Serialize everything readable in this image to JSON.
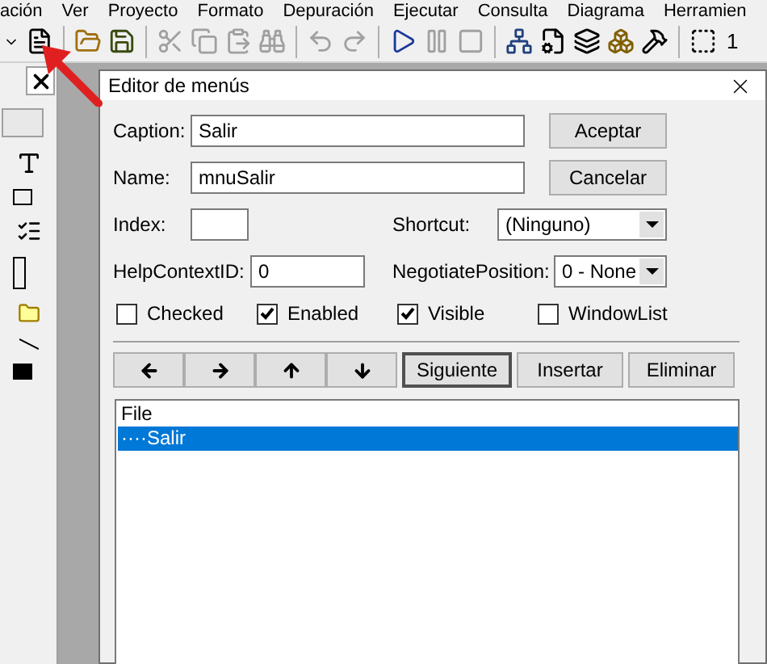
{
  "menu_bar": [
    "ación",
    "Ver",
    "Proyecto",
    "Formato",
    "Depuración",
    "Ejecutar",
    "Consulta",
    "Diagrama",
    "Herramien"
  ],
  "toolbar": [
    {
      "kind": "dropdown",
      "disabled": false
    },
    {
      "kind": "menu-editor",
      "disabled": false
    },
    {
      "kind": "sep"
    },
    {
      "kind": "open",
      "disabled": false
    },
    {
      "kind": "save",
      "disabled": false
    },
    {
      "kind": "sep"
    },
    {
      "kind": "cut",
      "disabled": true
    },
    {
      "kind": "copy",
      "disabled": true
    },
    {
      "kind": "paste",
      "disabled": true
    },
    {
      "kind": "find",
      "disabled": true
    },
    {
      "kind": "sep"
    },
    {
      "kind": "undo",
      "disabled": true
    },
    {
      "kind": "redo",
      "disabled": true
    },
    {
      "kind": "sep"
    },
    {
      "kind": "run",
      "disabled": false
    },
    {
      "kind": "pause",
      "disabled": true
    },
    {
      "kind": "stop",
      "disabled": true
    },
    {
      "kind": "sep"
    },
    {
      "kind": "project",
      "disabled": false
    },
    {
      "kind": "properties",
      "disabled": false
    },
    {
      "kind": "layout",
      "disabled": false
    },
    {
      "kind": "objects",
      "disabled": false
    },
    {
      "kind": "tools",
      "disabled": false
    },
    {
      "kind": "sep"
    },
    {
      "kind": "selection",
      "disabled": false
    }
  ],
  "toolbar_text": "1",
  "dialog": {
    "title": "Editor de menús",
    "caption": {
      "label": "Caption:",
      "value": "Salir"
    },
    "name": {
      "label": "Name:",
      "value": "mnuSalir"
    },
    "index": {
      "label": "Index:"
    },
    "shortcut": {
      "label": "Shortcut:",
      "value": "(Ninguno)"
    },
    "help_context_id": {
      "label": "HelpContextID:",
      "value": "0"
    },
    "negotiate_position": {
      "label": "NegotiatePosition:",
      "value": "0 - None"
    },
    "buttons": [
      "Aceptar",
      "Cancelar"
    ],
    "checkboxes": [
      {
        "label": "Checked",
        "checked": false
      },
      {
        "label": "Enabled",
        "checked": true
      },
      {
        "label": "Visible",
        "checked": true
      },
      {
        "label": "WindowList",
        "checked": false
      }
    ],
    "nav_buttons": [
      {
        "kind": "left"
      },
      {
        "kind": "right"
      },
      {
        "kind": "up"
      },
      {
        "kind": "down"
      }
    ],
    "action_buttons": [
      {
        "label": "Siguiente",
        "selected": true
      },
      {
        "label": "Insertar",
        "selected": false
      },
      {
        "label": "Eliminar",
        "selected": false
      }
    ],
    "menu_list": [
      {
        "label": "File",
        "selected": false,
        "children": [
          {
            "label": "····Salir",
            "selected": true
          }
        ]
      }
    ]
  }
}
